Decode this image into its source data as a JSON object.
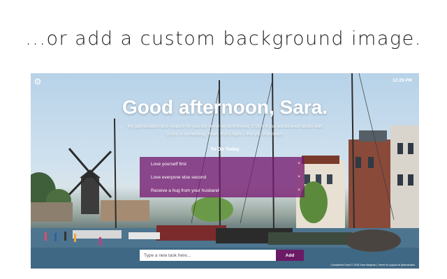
{
  "headline": "...or add a custom background image.",
  "app": {
    "settings_icon": "gear-icon",
    "clock": "12:29 PM",
    "greeting": "Good afternoon, Sara.",
    "compliment_line1": "My appreciation and respect for you will never be diminished, EVEN if you would wear socks with",
    "compliment_line2": "Crocs or something. Yeah, that's right. I like you that much.",
    "todo": {
      "heading": "To Do Today",
      "items": [
        {
          "label": "Love yourself first",
          "remove": "×"
        },
        {
          "label": "Love everyone else second",
          "remove": "×"
        },
        {
          "label": "Receive a hug from your husband",
          "remove": "×"
        }
      ],
      "input_placeholder": "Type a new task here...",
      "add_label": "Add"
    },
    "footer": "Compliment Dash © 2018 Sara Wegman | Tweet for support at @sarabuilds",
    "colors": {
      "accent": "#6b1a66",
      "panel": "#741a6e"
    }
  }
}
